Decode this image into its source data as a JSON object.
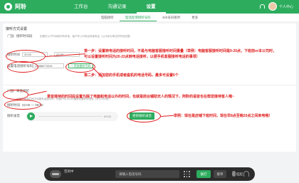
{
  "brand": {
    "name": "阿聆"
  },
  "topnav": {
    "items": [
      "工作台",
      "沟通记录",
      "设置"
    ],
    "active": 2
  },
  "topright": {
    "username": "个人中心"
  },
  "subnav": {
    "items": [
      "电脑接听",
      "电话反馈接听号码",
      "400号码接听",
      "更多"
    ],
    "active": 1
  },
  "section": {
    "title": "接听方式设置",
    "switch_label": "接听时间段",
    "switch_hint": "如果在以下时间段内有来电，客户呼入时将会转接电话（以分钟为单位的时段设置）",
    "time_label": "接听时间",
    "time_start": "20:00",
    "time_end": "22:00",
    "time_sep": "—",
    "phone_label": "设置电话接听号码",
    "phone_value": "13988273319",
    "add_button": "+ 添加接听号码",
    "step1_note": "第一步：设置转电话的接听时间，不是与电脑客服接听时间重叠（举例：电脑客服接听时间是9-20点，下班前or本公司时，",
    "step1_note2": "可以设置接听时间为20-22点转电话接听，以便手机客服接听电话的事项）",
    "step2_note": "第二步：添加您的手机或者座机的电话号码，最多可设置6个"
  },
  "voice": {
    "switch_label": "录音接听",
    "switch_hint": "当您在休息时间中设置电话接听时，在客户呼入时可播放设置好的语音（非工作时段）",
    "time_label": "接听时间",
    "time_value": "22:00 — 09:00",
    "audio_label": "接听录音",
    "audio_time": "00:00",
    "upload_button": "更新接听录音",
    "note_top": "录音接待的时间段设置为除了电脑和电话以外的时间，也就是前台辅助无人的情况下，阿聆的语音也在帮您接待客人哦~",
    "note_bottom": "举例：现在是店铺下班时间，现在早8点至晚20点之间来电哦！"
  },
  "callbar": {
    "status": "空闲中",
    "status_sub": "",
    "input_placeholder": "请输入电话号码",
    "dial_button": "拨打",
    "transfer_button": "接单",
    "right_label": "挂起"
  },
  "colors": {
    "accent": "#2dac5e",
    "annotation": "#e02020",
    "callbar": "#2c2c2c"
  }
}
